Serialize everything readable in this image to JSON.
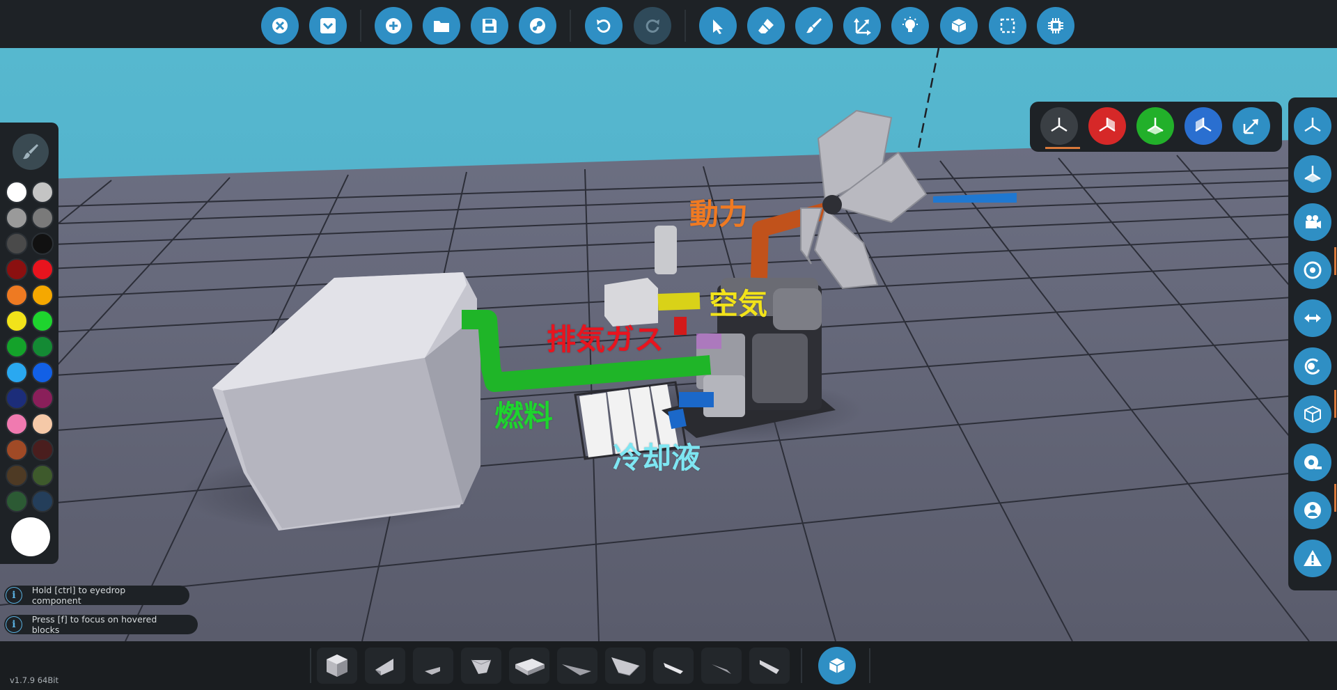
{
  "toolbar": {
    "groups": [
      [
        {
          "name": "close",
          "icon": "close-icon"
        },
        {
          "name": "collapse",
          "icon": "collapse-icon"
        }
      ],
      [
        {
          "name": "new",
          "icon": "plus-icon"
        },
        {
          "name": "open",
          "icon": "folder-icon"
        },
        {
          "name": "save",
          "icon": "save-icon"
        },
        {
          "name": "steam",
          "icon": "steam-icon"
        }
      ],
      [
        {
          "name": "undo",
          "icon": "undo-icon"
        },
        {
          "name": "redo",
          "icon": "redo-icon",
          "disabled": true
        }
      ],
      [
        {
          "name": "select",
          "icon": "cursor-icon"
        },
        {
          "name": "erase",
          "icon": "eraser-icon"
        },
        {
          "name": "paint",
          "icon": "brush-icon"
        },
        {
          "name": "move",
          "icon": "move-icon"
        },
        {
          "name": "lights",
          "icon": "bulb-icon"
        },
        {
          "name": "logic",
          "icon": "cube-icon"
        },
        {
          "name": "select-area",
          "icon": "marquee-icon"
        },
        {
          "name": "microprocessor",
          "icon": "chip-icon"
        }
      ]
    ]
  },
  "labels": {
    "power": "動力",
    "air": "空気",
    "exhaust": "排気ガス",
    "fuel": "燃料",
    "coolant": "冷却液"
  },
  "palette": {
    "swatches": [
      "#ffffff",
      "#c4c4c4",
      "#9a9a9a",
      "#7a7a7a",
      "#4a4a4a",
      "#111111",
      "#8b1010",
      "#e8141e",
      "#ee7a22",
      "#f5a800",
      "#f2e31a",
      "#1ed42e",
      "#14a22a",
      "#148a34",
      "#2aa8f0",
      "#1260e6",
      "#1c2d7a",
      "#8a1f5a",
      "#f07ab0",
      "#f5c9a8",
      "#a04a26",
      "#4a1e1e",
      "#4e3a24",
      "#3e5a2c",
      "#2c5a34",
      "#243e5a"
    ],
    "current_color": "#ffffff"
  },
  "gizmo": {
    "buttons": [
      {
        "name": "view-free",
        "color": "#3a3f44"
      },
      {
        "name": "view-x",
        "color": "#d62828"
      },
      {
        "name": "view-y",
        "color": "#22b02a"
      },
      {
        "name": "view-z",
        "color": "#2a6fd0"
      },
      {
        "name": "view-expand",
        "color": "#2f8fc4"
      }
    ]
  },
  "rightbar": {
    "buttons": [
      "axes-icon",
      "axes-filled-icon",
      "camera-icon",
      "target-icon",
      "arrows-icon",
      "rotate-icon",
      "box-icon",
      "tape-icon",
      "person-icon",
      "warning-icon"
    ]
  },
  "hints": [
    "Hold [ctrl] to eyedrop component",
    "Press [f] to focus on hovered blocks"
  ],
  "bottombar": {
    "version": "v1.7.9 64Bit",
    "blocks": [
      "cube-block",
      "wedge-block",
      "flat-wedge-block",
      "pyramid-block",
      "slab-block",
      "thin-wedge-block",
      "large-slab-block",
      "small-wedge-block",
      "spike-block",
      "angled-block"
    ]
  }
}
